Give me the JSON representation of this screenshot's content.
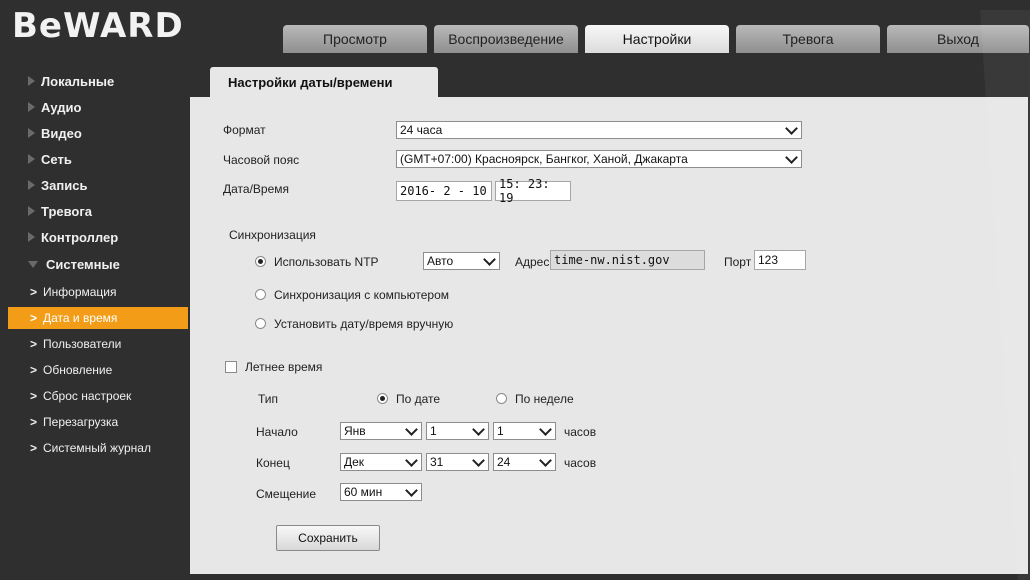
{
  "header": {
    "logo": "BeWARD",
    "tabs": [
      "Просмотр",
      "Воспроизведение",
      "Настройки",
      "Тревога",
      "Выход"
    ]
  },
  "sidebar": {
    "items": [
      "Локальные",
      "Аудио",
      "Видео",
      "Сеть",
      "Запись",
      "Тревога",
      "Контроллер",
      "Системные"
    ],
    "subitems": [
      "Информация",
      "Дата и время",
      "Пользователи",
      "Обновление",
      "Сброс настроек",
      "Перезагрузка",
      "Системный журнал"
    ],
    "active_subitem": "Дата и время",
    "accent_color": "#f39c17"
  },
  "panel": {
    "title": "Настройки даты/времени",
    "format_label": "Формат",
    "format_value": "24 часа",
    "timezone_label": "Часовой пояс",
    "timezone_value": "(GMT+07:00) Красноярск, Бангког, Ханой, Джакарта",
    "datetime_label": "Дата/Время",
    "date_value": "2016- 2 - 10",
    "time_value": "15: 23: 19",
    "sync_label": "Синхронизация",
    "ntp_label": "Использовать NTP",
    "ntp_mode": "Авто",
    "address_label": "Адрес",
    "address_value": "time-nw.nist.gov",
    "port_label": "Порт",
    "port_value": "123",
    "sync_pc_label": "Синхронизация с компьютером",
    "manual_label": "Установить дату/время вручную",
    "dst_label": "Летнее время",
    "type_label": "Тип",
    "by_date_label": "По дате",
    "by_week_label": "По неделе",
    "start_label": "Начало",
    "start_month": "Янв",
    "start_day": "1",
    "start_hour": "1",
    "hours_label": "часов",
    "end_label": "Конец",
    "end_month": "Дек",
    "end_day": "31",
    "end_hour": "24",
    "offset_label": "Смещение",
    "offset_value": "60 мин",
    "save_label": "Сохранить"
  }
}
